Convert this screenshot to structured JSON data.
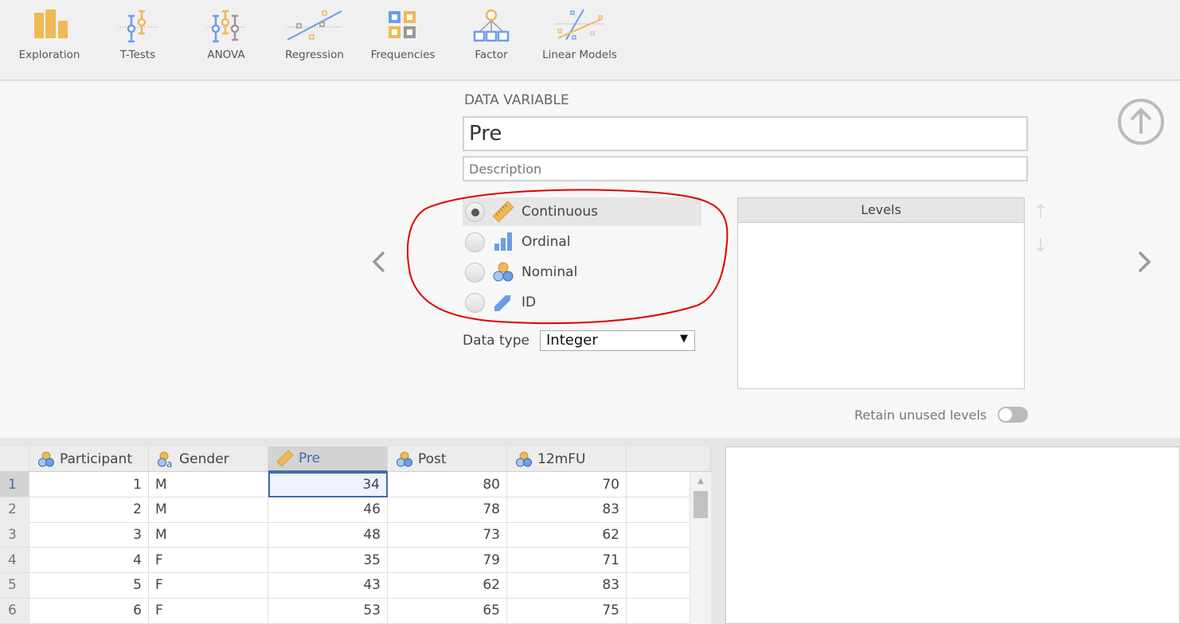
{
  "toolbar": {
    "items": [
      {
        "label": "Exploration",
        "icon": "exploration-icon"
      },
      {
        "label": "T-Tests",
        "icon": "ttests-icon"
      },
      {
        "label": "ANOVA",
        "icon": "anova-icon"
      },
      {
        "label": "Regression",
        "icon": "regression-icon"
      },
      {
        "label": "Frequencies",
        "icon": "frequencies-icon"
      },
      {
        "label": "Factor",
        "icon": "factor-icon"
      },
      {
        "label": "Linear Models",
        "icon": "linear-models-icon"
      }
    ]
  },
  "setup": {
    "heading": "DATA VARIABLE",
    "name_value": "Pre",
    "description_placeholder": "Description",
    "measure_types": [
      {
        "label": "Continuous",
        "icon": "ruler-icon",
        "selected": true
      },
      {
        "label": "Ordinal",
        "icon": "bar-chart-icon",
        "selected": false
      },
      {
        "label": "Nominal",
        "icon": "nominal-circles-icon",
        "selected": false
      },
      {
        "label": "ID",
        "icon": "tag-icon",
        "selected": false
      }
    ],
    "data_type_label": "Data type",
    "data_type_value": "Integer",
    "levels_header": "Levels",
    "retain_unused_label": "Retain unused levels",
    "retain_unused_on": false
  },
  "colors": {
    "accent": "#3e6da9",
    "orange": "#f0b956",
    "blue": "#6b9de8",
    "annotation": "#e00000"
  },
  "grid": {
    "columns": [
      {
        "name": "Participant",
        "type": "nominal",
        "active": false
      },
      {
        "name": "Gender",
        "type": "nominal-text",
        "active": false
      },
      {
        "name": "Pre",
        "type": "continuous",
        "active": true
      },
      {
        "name": "Post",
        "type": "nominal",
        "active": false
      },
      {
        "name": "12mFU",
        "type": "nominal",
        "active": false
      }
    ],
    "rows": [
      [
        "1",
        "1",
        "M",
        "34",
        "80",
        "70"
      ],
      [
        "2",
        "2",
        "M",
        "46",
        "78",
        "83"
      ],
      [
        "3",
        "3",
        "M",
        "48",
        "73",
        "62"
      ],
      [
        "4",
        "4",
        "F",
        "35",
        "79",
        "71"
      ],
      [
        "5",
        "5",
        "F",
        "43",
        "62",
        "83"
      ],
      [
        "6",
        "6",
        "F",
        "53",
        "65",
        "75"
      ]
    ]
  }
}
